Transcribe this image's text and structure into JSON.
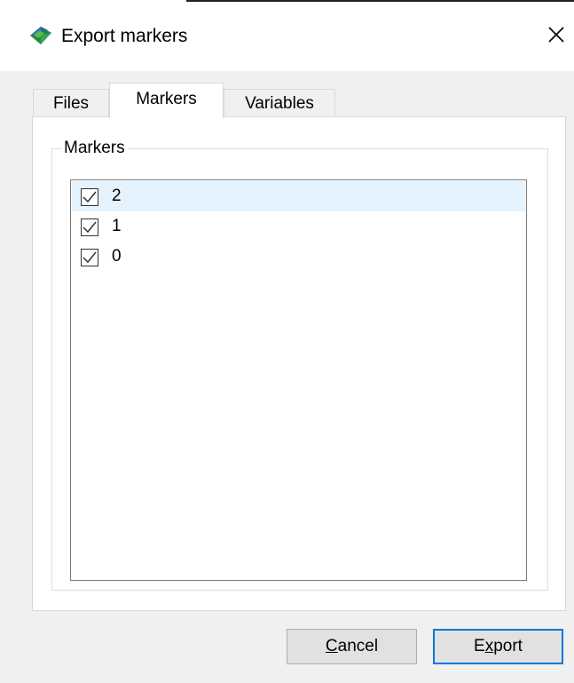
{
  "window": {
    "title": "Export markers",
    "icon": "app-icon",
    "close_icon": "close-icon"
  },
  "tabs": [
    {
      "label": "Files",
      "active": false
    },
    {
      "label": "Markers",
      "active": true
    },
    {
      "label": "Variables",
      "active": false
    }
  ],
  "markers_group": {
    "label": "Markers",
    "items": [
      {
        "label": "2",
        "checked": true,
        "selected": true
      },
      {
        "label": "1",
        "checked": true,
        "selected": false
      },
      {
        "label": "0",
        "checked": true,
        "selected": false
      }
    ]
  },
  "buttons": {
    "cancel": {
      "pre": "",
      "mnemonic": "C",
      "post": "ancel"
    },
    "export": {
      "pre": "E",
      "mnemonic": "x",
      "post": "port"
    }
  },
  "colors": {
    "selection": "#e5f3ff",
    "default_button_border": "#0078d7",
    "dialog_background": "#f0f0f0"
  }
}
